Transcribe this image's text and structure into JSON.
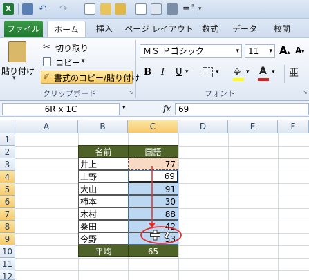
{
  "window": {
    "title": ""
  },
  "ribbon_tabs": [
    "ファイル",
    "ホーム",
    "挿入",
    "ページ レイアウト",
    "数式",
    "データ",
    "校閲"
  ],
  "clipboard": {
    "paste_label": "貼り付け",
    "cut_label": "切り取り",
    "copy_label": "コピー",
    "format_painter_label": "書式のコピー/貼り付け",
    "group_label": "クリップボード"
  },
  "font": {
    "font_name": "ＭＳ Ｐゴシック",
    "font_size": "11",
    "group_label": "フォント",
    "bold": "B",
    "italic": "I",
    "underline": "U",
    "grow": "A",
    "shrink": "A"
  },
  "formula_bar": {
    "name_box": "6R x 1C",
    "fx": "fx",
    "value": "69"
  },
  "columns": [
    "A",
    "B",
    "C",
    "D",
    "E",
    "F"
  ],
  "rows": [
    "1",
    "2",
    "3",
    "4",
    "5",
    "6",
    "7",
    "8",
    "9",
    "10",
    "11",
    "12"
  ],
  "table": {
    "header": [
      "名前",
      "国語"
    ],
    "rows": [
      [
        "井上",
        "77"
      ],
      [
        "上野",
        "69"
      ],
      [
        "大山",
        "91"
      ],
      [
        "柿本",
        "30"
      ],
      [
        "木村",
        "88"
      ],
      [
        "桑田",
        "42"
      ],
      [
        "今野",
        "53"
      ]
    ],
    "footer": [
      "平均",
      "65"
    ]
  },
  "colors": {
    "header_green": "#4f6228",
    "selection_blue": "#bcd7f2",
    "arrow_red": "#e03030",
    "file_tab_green": "#1f7a30"
  }
}
